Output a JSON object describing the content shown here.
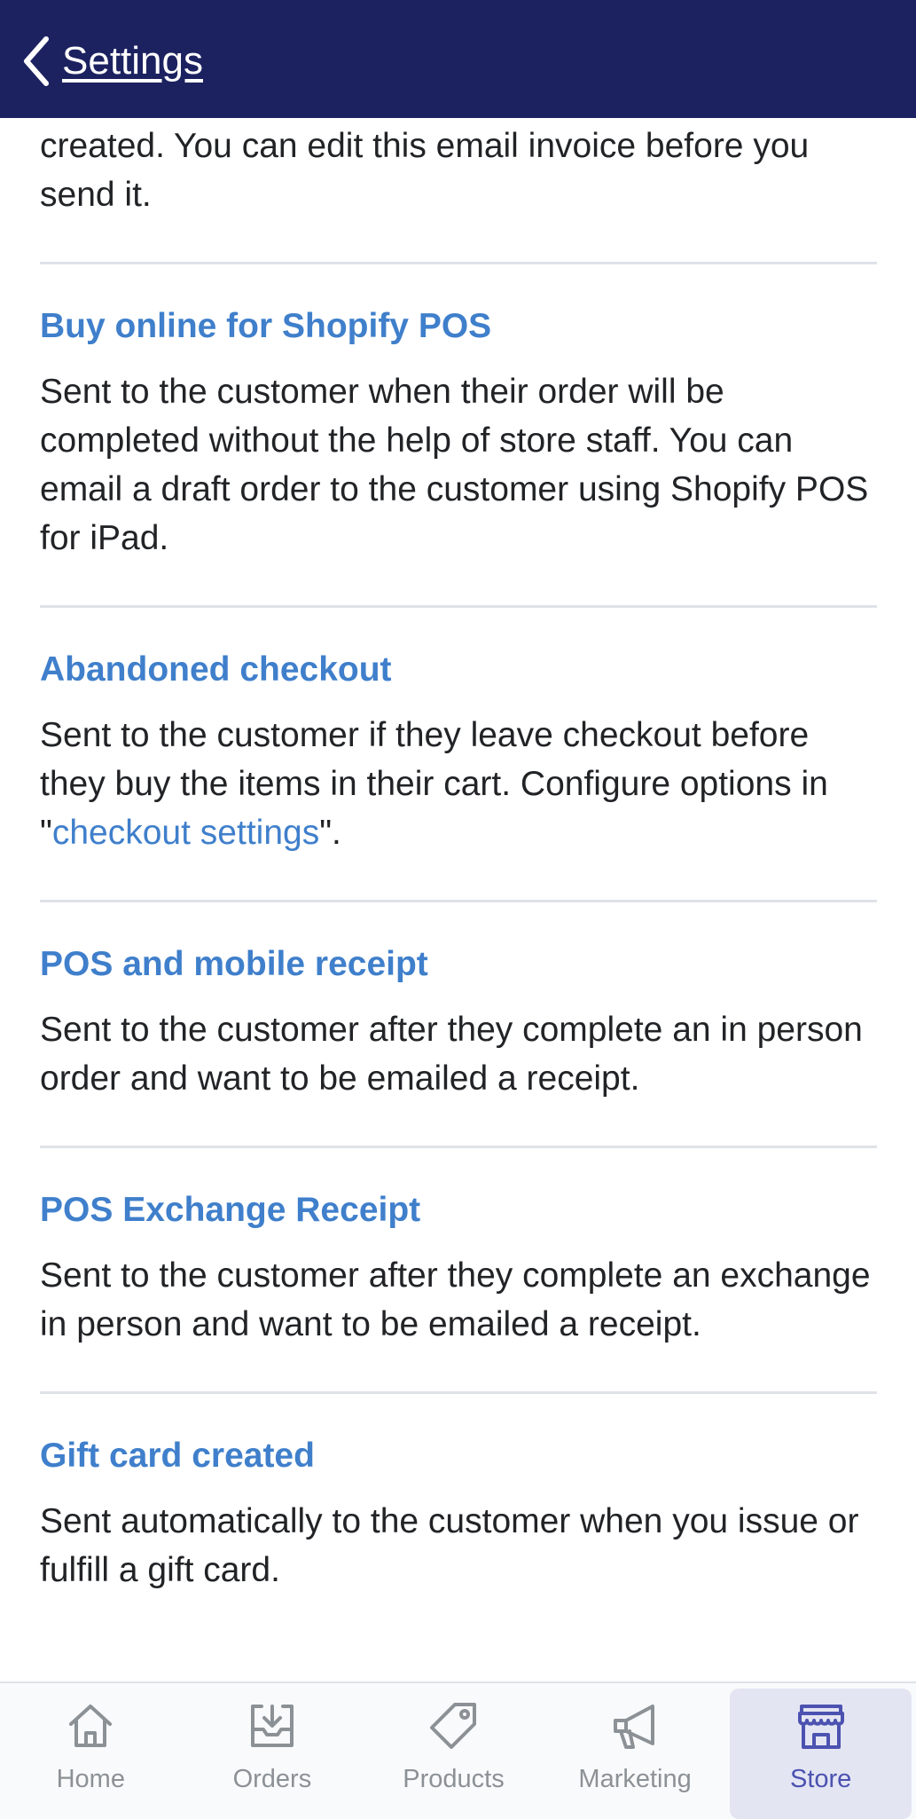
{
  "header": {
    "back_label": "Settings"
  },
  "intro_text": "created. You can edit this email invoice before you send it.",
  "sections": [
    {
      "title": "Buy online for Shopify POS",
      "text": "Sent to the customer when their order will be completed without the help of store staff. You can email a draft order to the customer using Shopify POS for iPad."
    },
    {
      "title": "Abandoned checkout",
      "text_before": "Sent to the customer if they leave checkout before they buy the items in their cart. Configure options in \"",
      "link": "checkout settings",
      "text_after": "\"."
    },
    {
      "title": "POS and mobile receipt",
      "text": "Sent to the customer after they complete an in person order and want to be emailed a receipt."
    },
    {
      "title": "POS Exchange Receipt",
      "text": "Sent to the customer after they complete an exchange in person and want to be emailed a receipt."
    },
    {
      "title": "Gift card created",
      "text": "Sent automatically to the customer when you issue or fulfill a gift card."
    }
  ],
  "tabs": [
    {
      "label": "Home",
      "icon": "home-icon"
    },
    {
      "label": "Orders",
      "icon": "orders-icon"
    },
    {
      "label": "Products",
      "icon": "tag-icon"
    },
    {
      "label": "Marketing",
      "icon": "megaphone-icon"
    },
    {
      "label": "Store",
      "icon": "store-icon",
      "active": true
    }
  ],
  "colors": {
    "header_bg": "#1c2260",
    "accent": "#3f7fcb",
    "active_tab": "#4b52b0"
  }
}
